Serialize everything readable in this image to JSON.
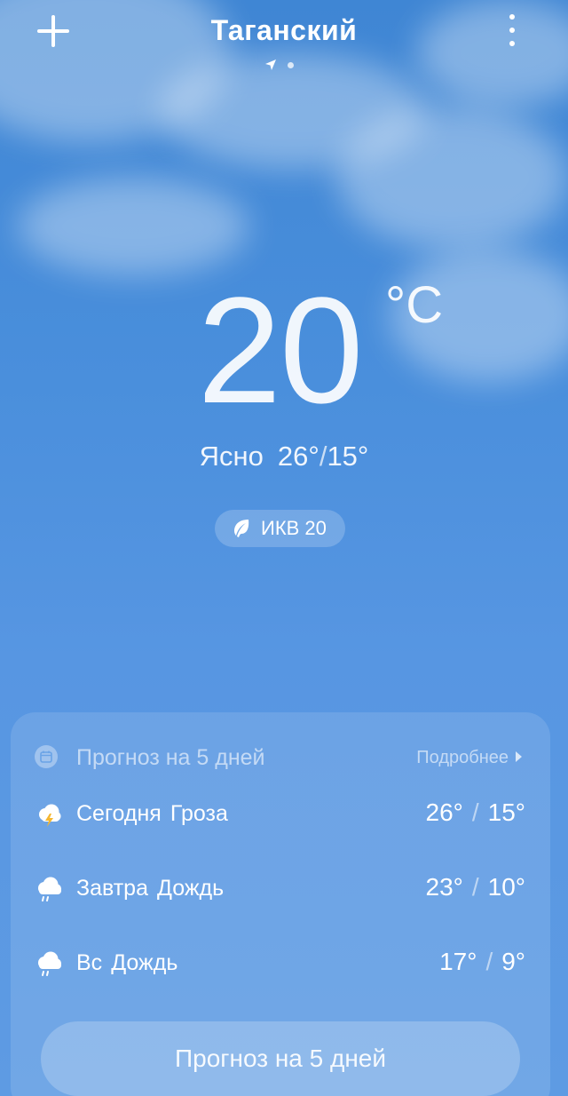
{
  "header": {
    "city": "Таганский",
    "add_icon": "plus-icon",
    "menu_icon": "more-vertical-icon",
    "location_icon": "location-arrow-icon"
  },
  "current": {
    "temperature": "20",
    "unit": "°C",
    "condition": "Ясно",
    "high": "26°",
    "low": "15°",
    "aqi_label": "ИКВ 20",
    "aqi_icon": "leaf-icon"
  },
  "forecast": {
    "title": "Прогноз на 5 дней",
    "details_link": "Подробнее",
    "icon": "calendar-icon",
    "days": [
      {
        "day": "Сегодня",
        "condition": "Гроза",
        "high": "26°",
        "low": "15°",
        "icon": "thunderstorm-icon"
      },
      {
        "day": "Завтра",
        "condition": "Дождь",
        "high": "23°",
        "low": "10°",
        "icon": "rain-icon"
      },
      {
        "day": "Вс",
        "condition": "Дождь",
        "high": "17°",
        "low": "9°",
        "icon": "rain-icon"
      }
    ],
    "button_label": "Прогноз на 5 дней"
  },
  "colors": {
    "sky_top": "#3f86d4",
    "sky_bottom": "#5e9be3",
    "accent_thunder": "#f5b731"
  }
}
